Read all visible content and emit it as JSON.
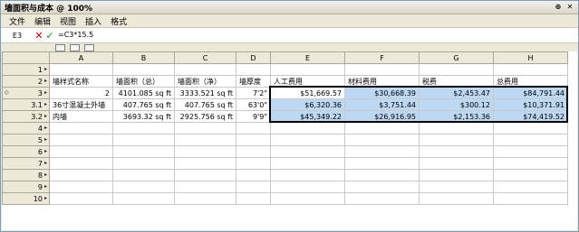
{
  "window": {
    "title": "墙面积与成本 @ 100%"
  },
  "menu": [
    "文件",
    "编辑",
    "视图",
    "插入",
    "格式"
  ],
  "formula_bar": {
    "cell_ref": "E3",
    "formula": "=C3*15.5"
  },
  "columns": [
    "A",
    "B",
    "C",
    "D",
    "E",
    "F",
    "G",
    "H"
  ],
  "rows": [
    {
      "num": "1",
      "marker": "",
      "cells": [
        "",
        "",
        "",
        "",
        "",
        "",
        "",
        ""
      ]
    },
    {
      "num": "2",
      "marker": "",
      "cells": [
        "墙样式名称",
        "墙面积（总）",
        "墙面积（净）",
        "墙厚度",
        "人工费用",
        "材料费用",
        "税费",
        "总费用"
      ]
    },
    {
      "num": "3",
      "marker": "◇",
      "cells": [
        "2",
        "4101.085 sq ft",
        "3333.521 sq ft",
        "7'2\"",
        "$51,669.57",
        "$30,668.39",
        "$2,453.47",
        "$84,791.44"
      ]
    },
    {
      "num": "3.1",
      "marker": "",
      "cells": [
        "36寸混凝土外墙",
        "407.765 sq ft",
        "407.765 sq ft",
        "63'0\"",
        "$6,320.36",
        "$3,751.44",
        "$300.12",
        "$10,371.91"
      ]
    },
    {
      "num": "3.2",
      "marker": "",
      "cells": [
        "内墙",
        "3693.32 sq ft",
        "2925.756 sq ft",
        "9'9\"",
        "$45,349.22",
        "$26,916.95",
        "$2,153.36",
        "$74,419.52"
      ]
    },
    {
      "num": "4",
      "marker": "",
      "cells": [
        "",
        "",
        "",
        "",
        "",
        "",
        "",
        ""
      ]
    },
    {
      "num": "5",
      "marker": "",
      "cells": [
        "",
        "",
        "",
        "",
        "",
        "",
        "",
        ""
      ]
    },
    {
      "num": "6",
      "marker": "",
      "cells": [
        "",
        "",
        "",
        "",
        "",
        "",
        "",
        ""
      ]
    },
    {
      "num": "7",
      "marker": "",
      "cells": [
        "",
        "",
        "",
        "",
        "",
        "",
        "",
        ""
      ]
    },
    {
      "num": "8",
      "marker": "",
      "cells": [
        "",
        "",
        "",
        "",
        "",
        "",
        "",
        ""
      ]
    },
    {
      "num": "9",
      "marker": "",
      "cells": [
        "",
        "",
        "",
        "",
        "",
        "",
        "",
        ""
      ]
    },
    {
      "num": "10",
      "marker": "",
      "cells": [
        "",
        "",
        "",
        "",
        "",
        "",
        "",
        ""
      ]
    }
  ],
  "colors": {
    "selection": "#bcd8f2",
    "header": "#ece9d8",
    "window_border": "#7f9db9"
  }
}
